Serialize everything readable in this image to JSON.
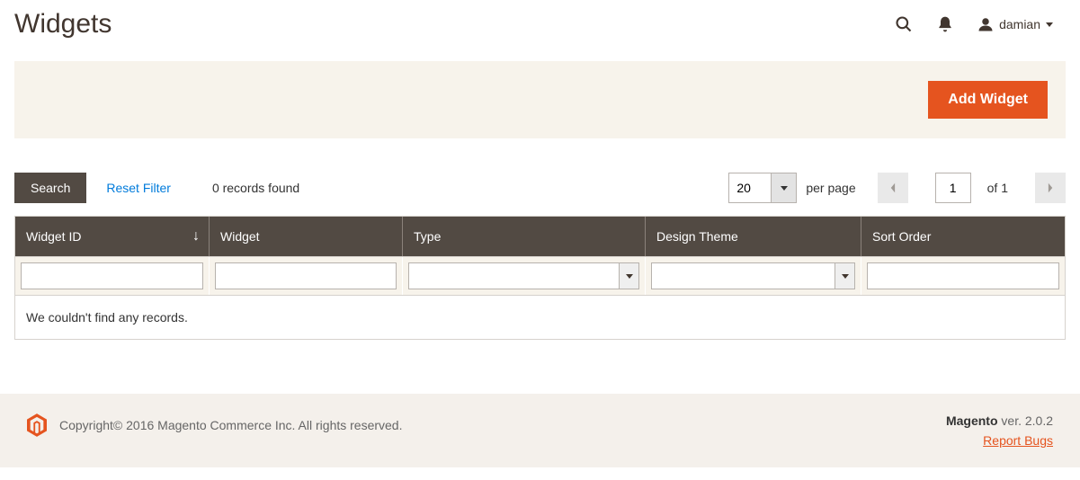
{
  "header": {
    "title": "Widgets",
    "user": "damian"
  },
  "action": {
    "add_button": "Add Widget"
  },
  "controls": {
    "search_button": "Search",
    "reset_filter": "Reset Filter",
    "records_found": "0 records found",
    "perpage_value": "20",
    "perpage_label": "per page",
    "page_value": "1",
    "of_pages": "of 1"
  },
  "table": {
    "columns": {
      "id": "Widget ID",
      "widget": "Widget",
      "type": "Type",
      "theme": "Design Theme",
      "order": "Sort Order"
    },
    "sort_indicator": "↓",
    "empty_message": "We couldn't find any records."
  },
  "footer": {
    "copyright": "Copyright© 2016 Magento Commerce Inc. All rights reserved.",
    "product": "Magento",
    "version": " ver. 2.0.2",
    "report_bugs": "Report Bugs"
  }
}
